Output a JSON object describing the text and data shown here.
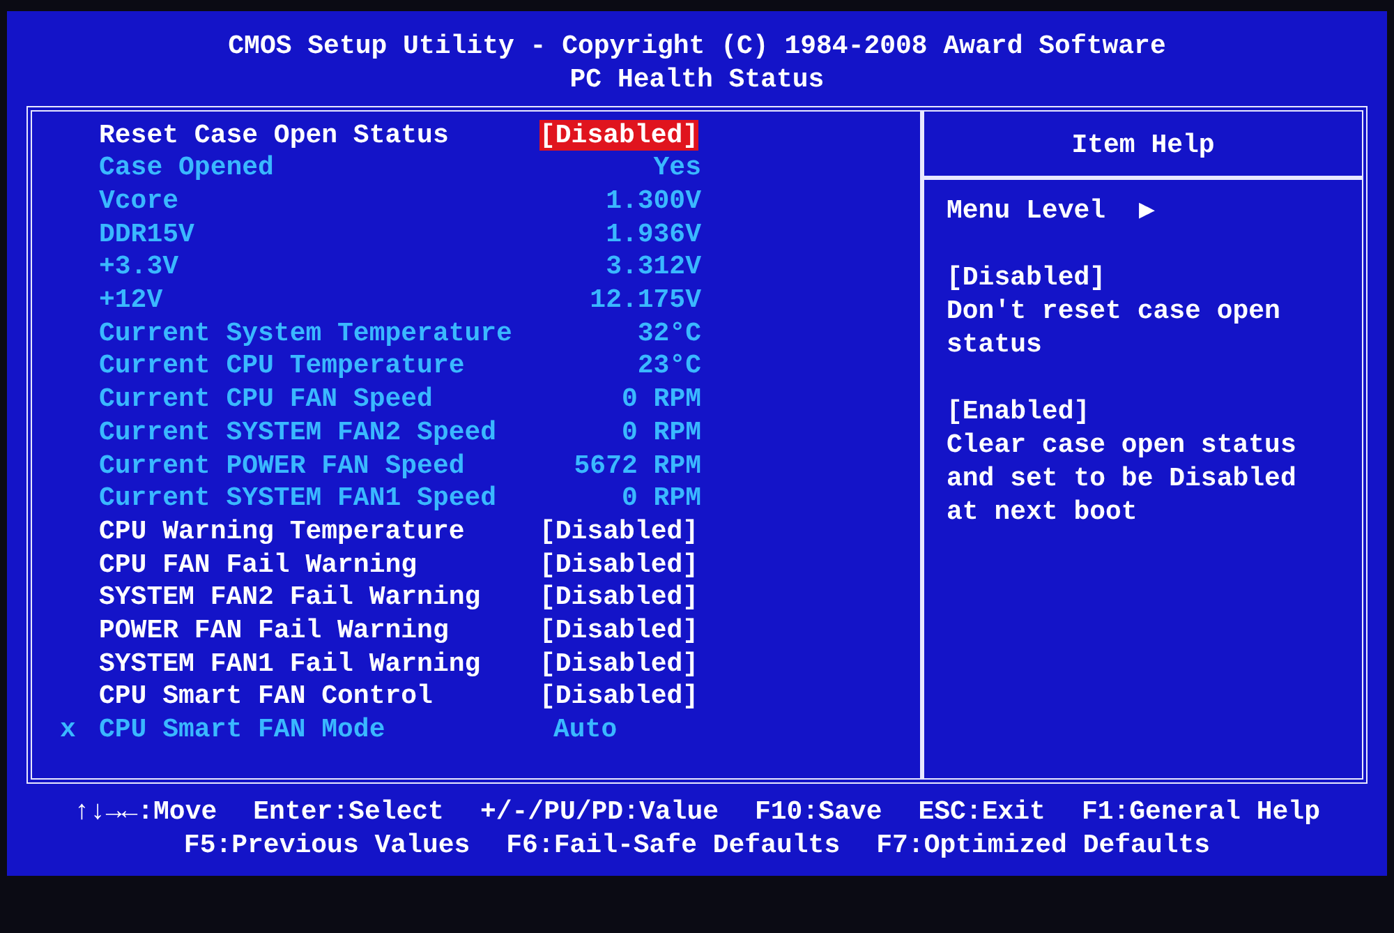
{
  "header": {
    "title": "CMOS Setup Utility - Copyright (C) 1984-2008 Award Software",
    "subtitle": "PC Health Status"
  },
  "settings": [
    {
      "kind": "setting",
      "label": "Reset Case Open Status",
      "value": "[Disabled]",
      "selected": true
    },
    {
      "kind": "info",
      "label": "Case Opened",
      "value": "Yes",
      "selected": false
    },
    {
      "kind": "info",
      "label": "Vcore",
      "value": "1.300V",
      "selected": false
    },
    {
      "kind": "info",
      "label": "DDR15V",
      "value": "1.936V",
      "selected": false
    },
    {
      "kind": "info",
      "label": "+3.3V",
      "value": "3.312V",
      "selected": false
    },
    {
      "kind": "info",
      "label": "+12V",
      "value": "12.175V",
      "selected": false
    },
    {
      "kind": "info",
      "label": "Current System Temperature",
      "value": "32°C",
      "selected": false
    },
    {
      "kind": "info",
      "label": "Current CPU Temperature",
      "value": "23°C",
      "selected": false
    },
    {
      "kind": "info",
      "label": "Current CPU FAN Speed",
      "value": "0 RPM",
      "selected": false
    },
    {
      "kind": "info",
      "label": "Current SYSTEM FAN2 Speed",
      "value": "0 RPM",
      "selected": false
    },
    {
      "kind": "info",
      "label": "Current POWER FAN Speed",
      "value": "5672 RPM",
      "selected": false
    },
    {
      "kind": "info",
      "label": "Current SYSTEM FAN1 Speed",
      "value": "0 RPM",
      "selected": false
    },
    {
      "kind": "setting",
      "label": "CPU Warning Temperature",
      "value": "[Disabled]",
      "selected": false
    },
    {
      "kind": "setting",
      "label": "CPU FAN Fail Warning",
      "value": "[Disabled]",
      "selected": false
    },
    {
      "kind": "setting",
      "label": "SYSTEM FAN2 Fail Warning",
      "value": "[Disabled]",
      "selected": false
    },
    {
      "kind": "setting",
      "label": "POWER FAN Fail Warning",
      "value": "[Disabled]",
      "selected": false
    },
    {
      "kind": "setting",
      "label": "SYSTEM FAN1 Fail Warning",
      "value": "[Disabled]",
      "selected": false
    },
    {
      "kind": "setting",
      "label": "CPU Smart FAN Control",
      "value": "[Disabled]",
      "selected": false
    },
    {
      "kind": "locked",
      "marker": "x",
      "label": "CPU Smart FAN Mode",
      "value": "Auto",
      "selected": false
    }
  ],
  "help": {
    "title": "Item Help",
    "menu_level": "Menu Level",
    "menu_level_arrow": "▶",
    "paragraphs": [
      {
        "heading": "[Disabled]",
        "text": "Don't reset case open status"
      },
      {
        "heading": "[Enabled]",
        "text": "Clear case open status and set to be Disabled at next boot"
      }
    ]
  },
  "footer": [
    [
      "↑↓→←:Move",
      "Enter:Select",
      "+/-/PU/PD:Value",
      "F10:Save",
      "ESC:Exit",
      "F1:General Help"
    ],
    [
      "F5:Previous Values",
      "F6:Fail-Safe Defaults",
      "F7:Optimized Defaults"
    ]
  ]
}
